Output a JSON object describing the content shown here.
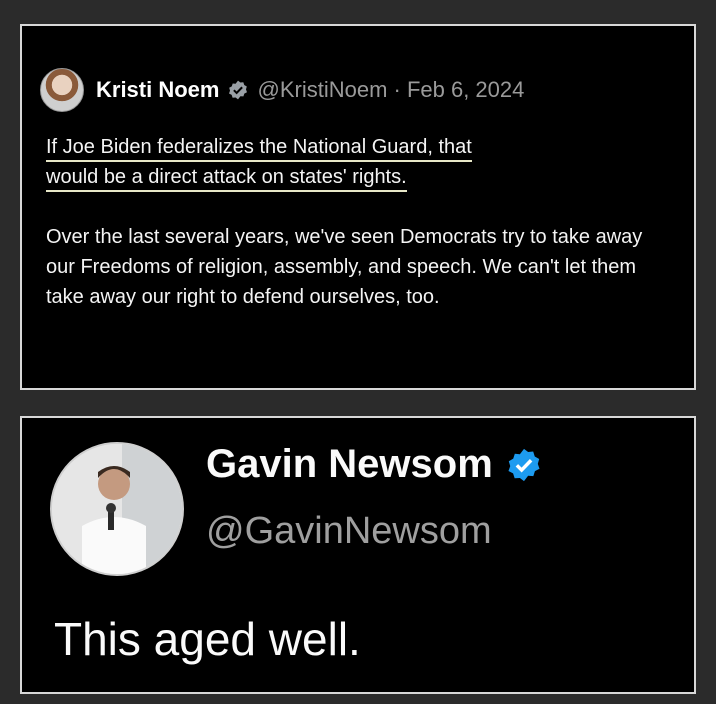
{
  "tweet": {
    "author_name": "Kristi Noem",
    "author_handle": "@KristiNoem · Feb 6, 2024",
    "highlight_line1": "If Joe Biden federalizes the National Guard, that",
    "highlight_line2": "would be a direct attack on states' rights.",
    "paragraph2": "Over the last several years, we've seen Democrats try to take away our Freedoms of religion, assembly, and speech. We can't let them take away our right to defend ourselves, too."
  },
  "reply": {
    "author_name": "Gavin Newsom",
    "author_handle": "@GavinNewsom",
    "text": "This aged well."
  },
  "icons": {
    "verified": "verified-badge-icon",
    "avatar_noem": "avatar",
    "avatar_newsom": "avatar"
  },
  "colors": {
    "background": "#2b2b2b",
    "card": "#000000",
    "border": "#d8d8d8",
    "verified_blue": "#1d9bf0",
    "handle_gray": "#9a9a9a"
  }
}
